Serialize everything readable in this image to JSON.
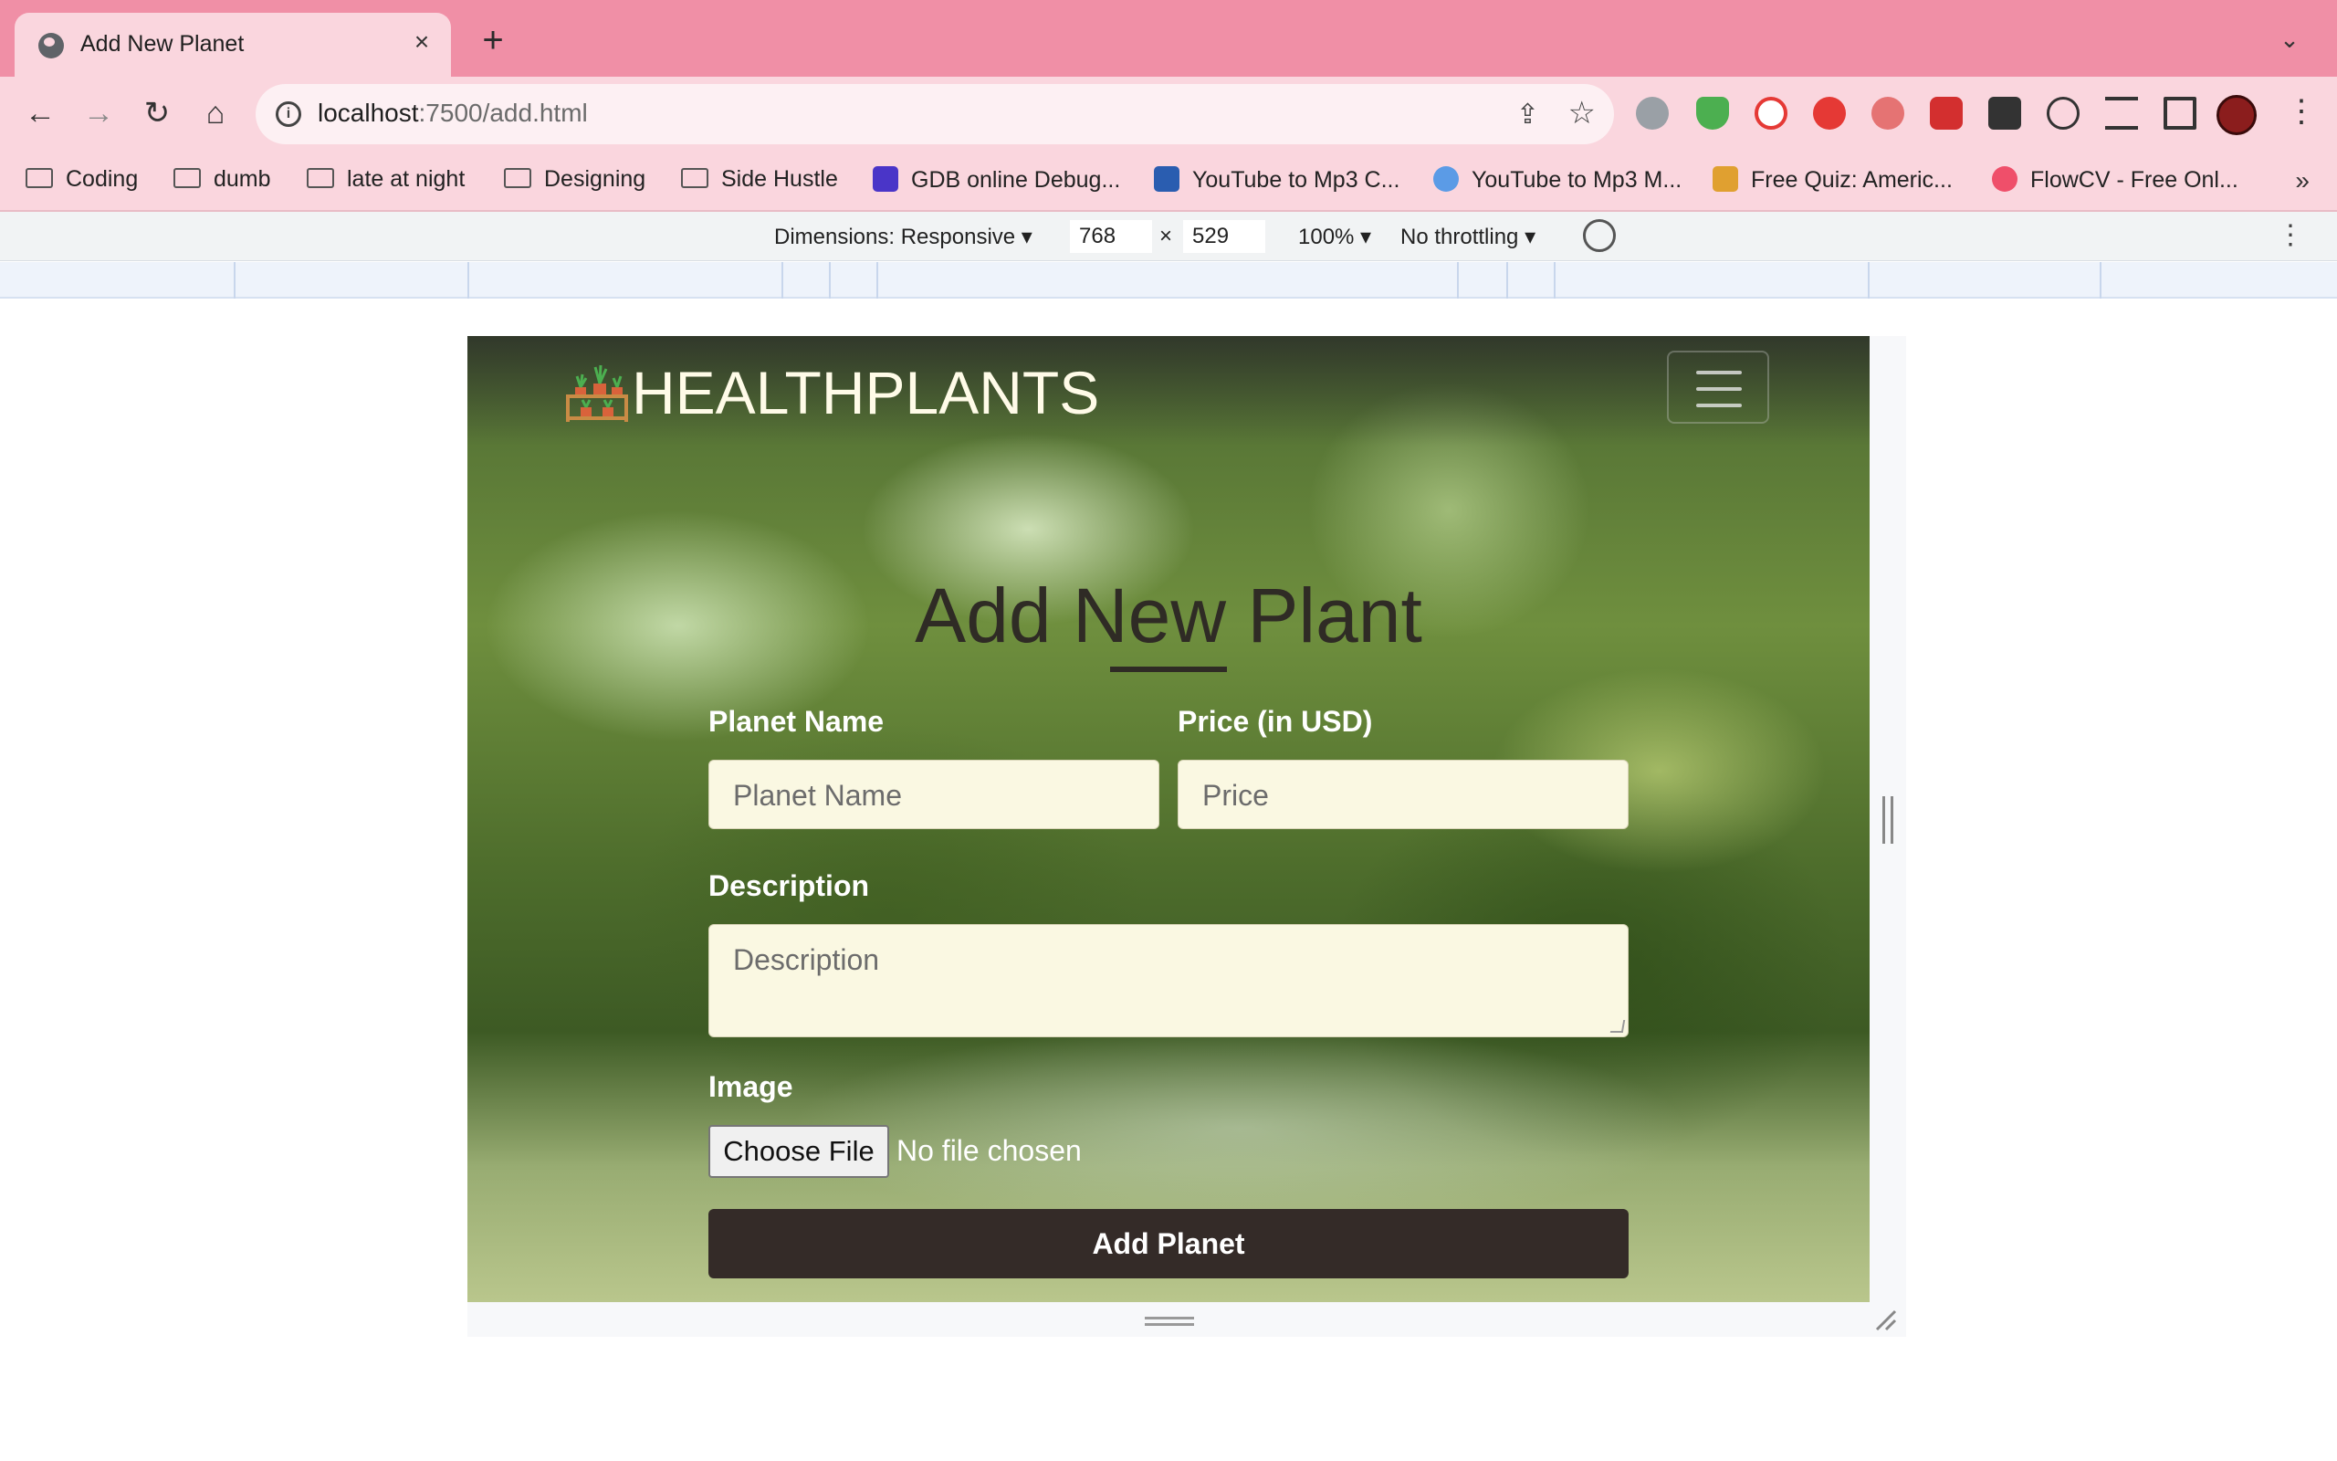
{
  "browser": {
    "tab_title": "Add New Planet",
    "tab_close": "×",
    "new_tab": "+",
    "tab_list": "⌄",
    "url_host": "localhost",
    "url_rest": ":7500/add.html",
    "back": "←",
    "forward": "→",
    "reload": "↻",
    "home": "⌂",
    "share": "⇪",
    "star": "☆",
    "menu": "⋮",
    "bookmarks": [
      {
        "label": "Coding",
        "icon": "folder-icon"
      },
      {
        "label": "dumb",
        "icon": "folder-icon"
      },
      {
        "label": "late at night",
        "icon": "folder-icon"
      },
      {
        "label": "Designing",
        "icon": "folder-icon"
      },
      {
        "label": "Side Hustle",
        "icon": "folder-icon"
      },
      {
        "label": "GDB online Debug...",
        "icon": "gdb-icon"
      },
      {
        "label": "YouTube to Mp3 C...",
        "icon": "download-icon"
      },
      {
        "label": "YouTube to Mp3 M...",
        "icon": "cloud-download-icon"
      },
      {
        "label": "Free Quiz: Americ...",
        "icon": "quiz-icon"
      },
      {
        "label": "FlowCV - Free Onl...",
        "icon": "flowcv-icon"
      }
    ],
    "bookmarks_more": "»"
  },
  "devtools": {
    "dimensions_label": "Dimensions: Responsive ▾",
    "width": "768",
    "times": "×",
    "height": "529",
    "zoom": "100% ▾",
    "throttling": "No throttling ▾",
    "menu": "⋮"
  },
  "page": {
    "brand": "HEALTHPLANTS",
    "form_title": "Add New Plant",
    "name_label": "Planet Name",
    "name_placeholder": "Planet Name",
    "price_label": "Price (in USD)",
    "price_placeholder": "Price",
    "description_label": "Description",
    "description_placeholder": "Description",
    "image_label": "Image",
    "choose_file": "Choose File",
    "no_file": "No file chosen",
    "submit": "Add Planet"
  },
  "colors": {
    "tabstrip": "#f08fa6",
    "toolbar": "#fad6de",
    "input_bg": "#faf8e2",
    "button_bg": "#342b28",
    "brand_text": "#fffbe8"
  }
}
